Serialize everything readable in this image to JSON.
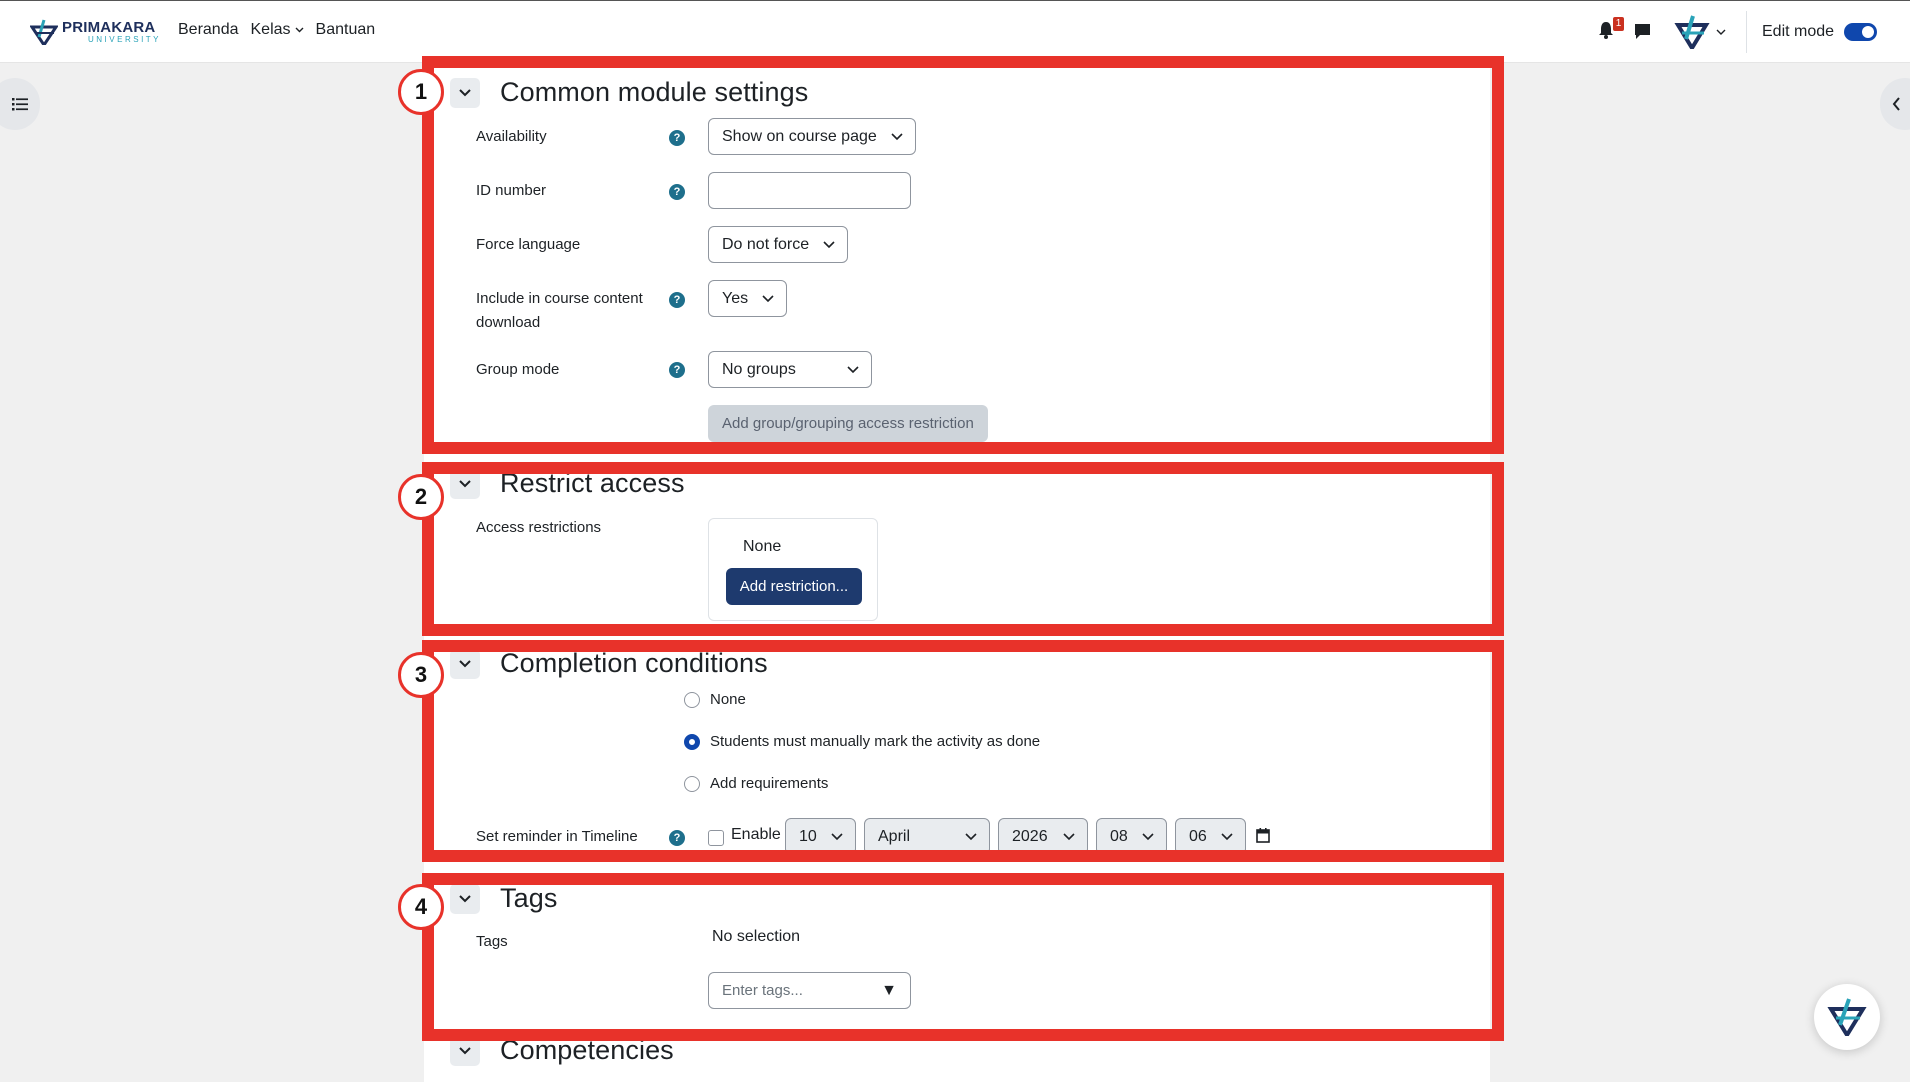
{
  "brand": {
    "line1": "PRIMAKARA",
    "line2": "UNIVERSITY"
  },
  "nav": {
    "items": [
      "Beranda",
      "Kelas",
      "Bantuan"
    ]
  },
  "header": {
    "notification_count": "1",
    "edit_mode_label": "Edit mode",
    "edit_mode_on": true
  },
  "common": {
    "title": "Common module settings",
    "availability_label": "Availability",
    "availability_value": "Show on course page",
    "idnumber_label": "ID number",
    "idnumber_value": "",
    "lang_label": "Force language",
    "lang_value": "Do not force",
    "download_label": "Include in course content download",
    "download_value": "Yes",
    "groupmode_label": "Group mode",
    "groupmode_value": "No groups",
    "add_group_btn": "Add group/grouping access restriction"
  },
  "restrict": {
    "title": "Restrict access",
    "label": "Access restrictions",
    "none": "None",
    "add_btn": "Add restriction..."
  },
  "completion": {
    "title": "Completion conditions",
    "options": [
      "None",
      "Students must manually mark the activity as done",
      "Add requirements"
    ],
    "selected_index": 1,
    "reminder_label": "Set reminder in Timeline",
    "enable_label": "Enable",
    "day": "10",
    "month": "April",
    "year": "2026",
    "hour": "08",
    "minute": "06"
  },
  "tags": {
    "title": "Tags",
    "label": "Tags",
    "selection": "No selection",
    "placeholder": "Enter tags..."
  },
  "competencies": {
    "title": "Competencies"
  },
  "annotations": [
    "1",
    "2",
    "3",
    "4"
  ],
  "colors": {
    "highlight": "#e8322a",
    "primary": "#1e3a6e",
    "toggle": "#0f47ad",
    "help": "#1e6f8c"
  }
}
